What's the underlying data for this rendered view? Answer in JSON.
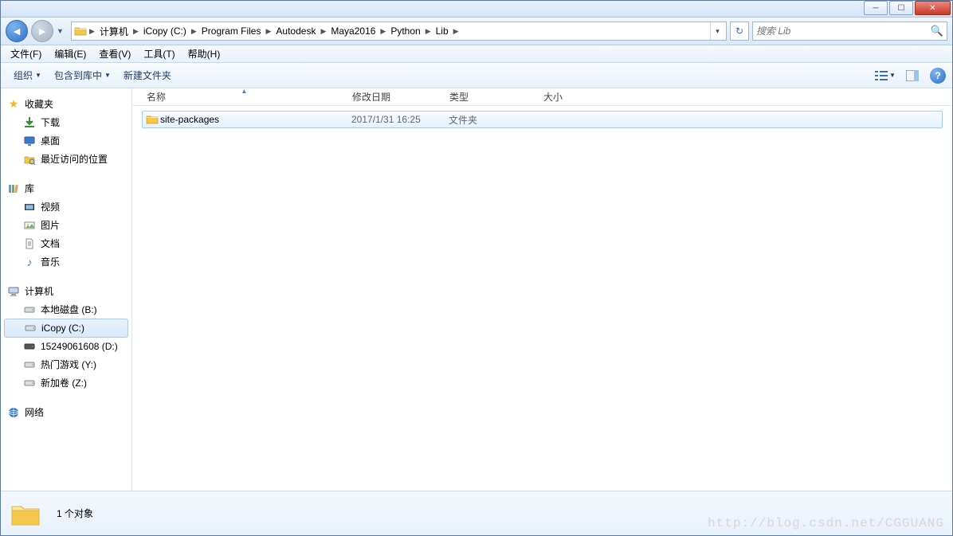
{
  "titlebar": {},
  "nav": {
    "breadcrumbs": [
      "计算机",
      "iCopy (C:)",
      "Program Files",
      "Autodesk",
      "Maya2016",
      "Python",
      "Lib"
    ]
  },
  "search": {
    "placeholder": "搜索 Lib"
  },
  "menu": {
    "file": "文件(F)",
    "edit": "编辑(E)",
    "view": "查看(V)",
    "tools": "工具(T)",
    "help": "帮助(H)"
  },
  "toolbar": {
    "organize": "组织",
    "include": "包含到库中",
    "newfolder": "新建文件夹"
  },
  "sidebar": {
    "favorites": {
      "label": "收藏夹",
      "items": [
        {
          "icon": "download",
          "label": "下载"
        },
        {
          "icon": "desktop",
          "label": "桌面"
        },
        {
          "icon": "recent",
          "label": "最近访问的位置"
        }
      ]
    },
    "libraries": {
      "label": "库",
      "items": [
        {
          "icon": "video",
          "label": "视频"
        },
        {
          "icon": "pictures",
          "label": "图片"
        },
        {
          "icon": "documents",
          "label": "文档"
        },
        {
          "icon": "music",
          "label": "音乐"
        }
      ]
    },
    "computer": {
      "label": "计算机",
      "items": [
        {
          "icon": "drive",
          "label": "本地磁盘 (B:)"
        },
        {
          "icon": "drive",
          "label": "iCopy (C:)",
          "selected": true
        },
        {
          "icon": "drive",
          "label": "15249061608 (D:)"
        },
        {
          "icon": "drive",
          "label": "热门游戏 (Y:)"
        },
        {
          "icon": "drive",
          "label": "新加卷 (Z:)"
        }
      ]
    },
    "network": {
      "label": "网络"
    }
  },
  "columns": {
    "name": "名称",
    "date": "修改日期",
    "type": "类型",
    "size": "大小"
  },
  "items": [
    {
      "name": "site-packages",
      "date": "2017/1/31 16:25",
      "type": "文件夹",
      "size": ""
    }
  ],
  "status": {
    "count": "1 个对象"
  },
  "watermark": "http://blog.csdn.net/CGGUANG"
}
